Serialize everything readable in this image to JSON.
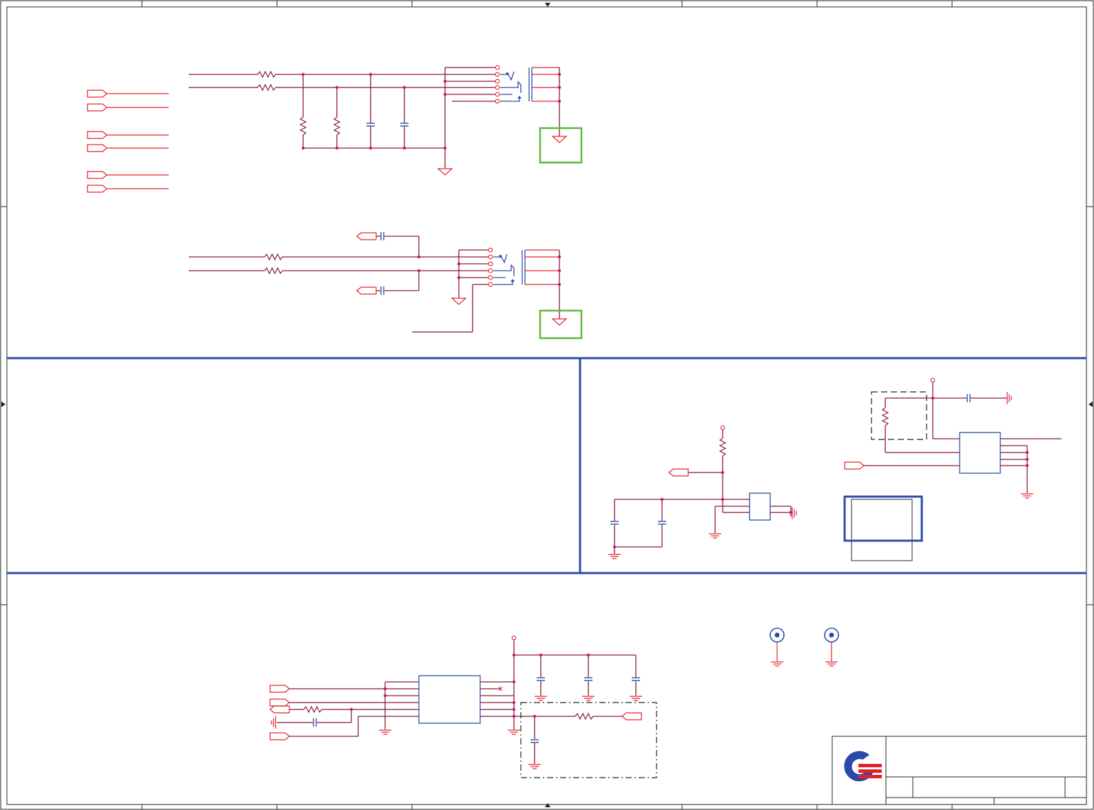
{
  "title_block": {
    "logo": "quanta-logo",
    "title": "",
    "size_label": "",
    "doc_number": "",
    "rev": ""
  },
  "colors": {
    "wire": "#8b1538",
    "symbol_red": "#e5202a",
    "symbol_blue": "#2b4aa8",
    "highlight_green": "#5cb83c",
    "junction": "#c2187a"
  }
}
